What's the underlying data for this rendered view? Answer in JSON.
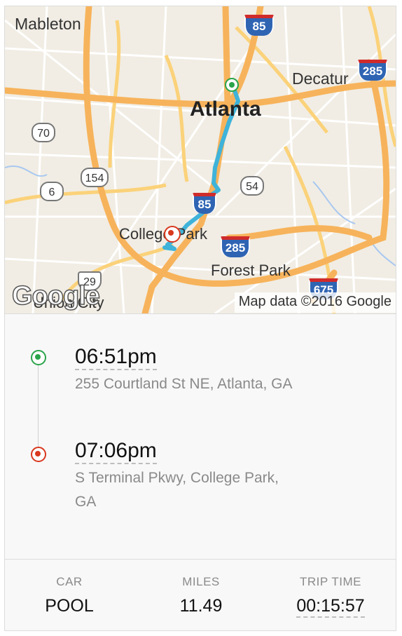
{
  "map": {
    "labels": {
      "mableton": "Mableton",
      "decatur": "Decatur",
      "atlanta": "Atlanta",
      "college_park": "College Park",
      "forest_park": "Forest Park",
      "union_city": "Union City"
    },
    "shields": {
      "i85_top": "85",
      "i285_right": "285",
      "us70": "70",
      "sr154": "154",
      "sr6": "6",
      "sr54": "54",
      "i85_mid": "85",
      "i285_mid": "285",
      "us29": "29",
      "i675": "675"
    },
    "logo": "Google",
    "attribution": "Map data ©2016 Google",
    "route_color": "#3fb3d9",
    "start_color": "#2aa44a",
    "end_color": "#d9381e"
  },
  "trip": {
    "pickup": {
      "time": "06:51pm",
      "address": "255 Courtland St NE, Atlanta, GA"
    },
    "dropoff": {
      "time": "07:06pm",
      "address": "S Terminal Pkwy, College Park, GA"
    }
  },
  "stats": {
    "car": {
      "label": "CAR",
      "value": "POOL"
    },
    "miles": {
      "label": "MILES",
      "value": "11.49"
    },
    "trip_time": {
      "label": "TRIP TIME",
      "value": "00:15:57"
    }
  }
}
